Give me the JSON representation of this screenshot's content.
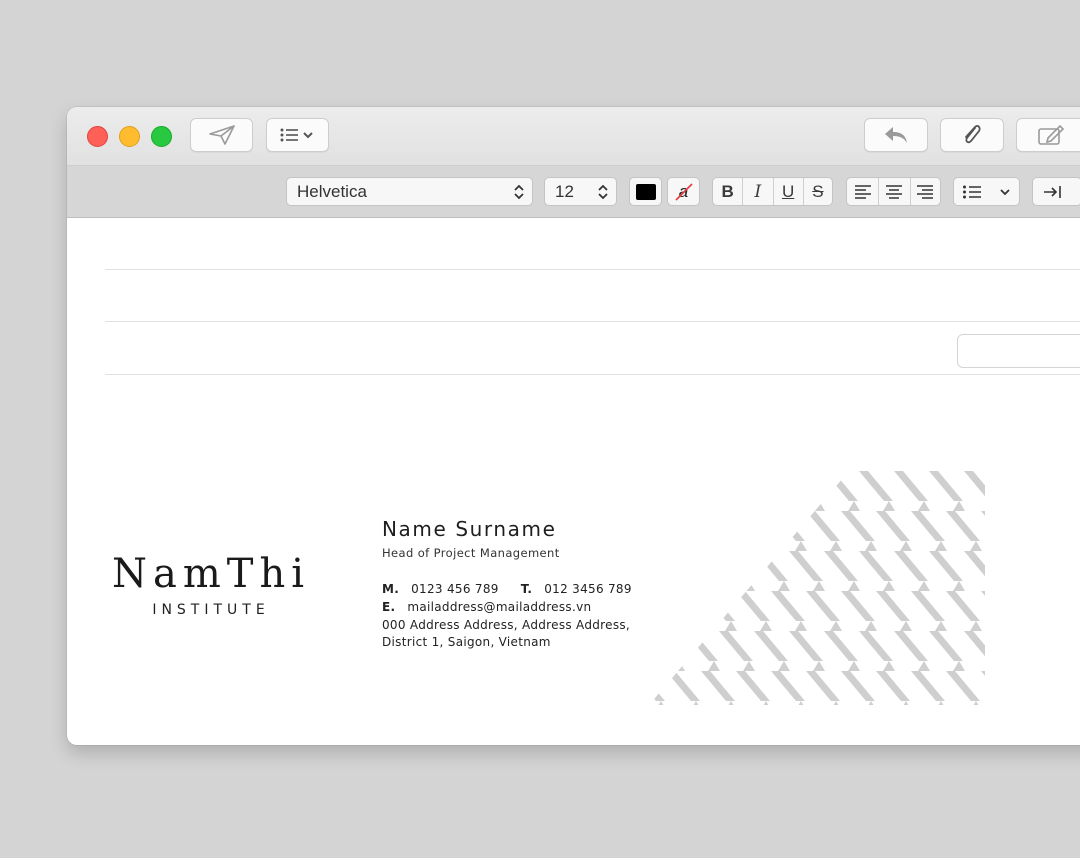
{
  "toolbar": {
    "send_icon": "paper-plane-icon",
    "header_fields_icon": "list-chevron-icon",
    "reply_icon": "reply-arrow-icon",
    "attach_icon": "paperclip-icon",
    "markup_icon": "compose-icon"
  },
  "format": {
    "font_family": "Helvetica",
    "font_size": "12",
    "text_color": "#000000",
    "bold": "B",
    "italic": "I",
    "underline": "U",
    "strike": "S",
    "highlight": "a"
  },
  "signature": {
    "logo_name": "NamThi",
    "logo_sub": "INSTITUTE",
    "name": "Name Surname",
    "title": "Head of Project Management",
    "mobile_label": "M.",
    "mobile": "0123 456 789",
    "tel_label": "T.",
    "tel": "012 3456 789",
    "email_label": "E.",
    "email": "mailaddress@mailaddress.vn",
    "address1": "000 Address Address, Address Address,",
    "address2": "District 1, Saigon, Vietnam"
  },
  "colors": {
    "close": "#fe5f57",
    "minimize": "#febc2e",
    "zoom": "#28c840",
    "pattern": "#cfcfcf"
  }
}
